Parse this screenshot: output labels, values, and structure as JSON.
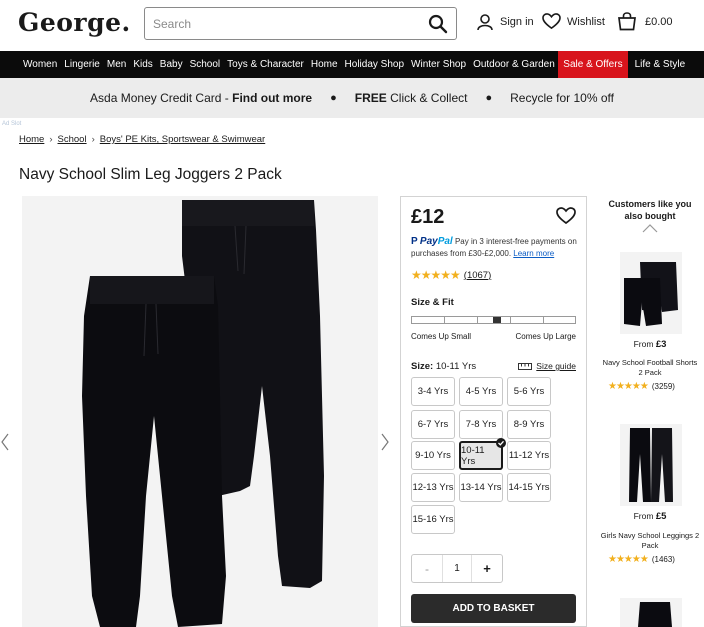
{
  "header": {
    "logo": "George.",
    "search_placeholder": "Search",
    "signin": "Sign in",
    "wishlist": "Wishlist",
    "basket_total": "£0.00"
  },
  "nav": {
    "items": [
      "Women",
      "Lingerie",
      "Men",
      "Kids",
      "Baby",
      "School",
      "Toys & Character",
      "Home",
      "Holiday Shop",
      "Winter Shop",
      "Outdoor & Garden",
      "Sale & Offers",
      "Life & Style"
    ],
    "highlight_color": "#d8141c"
  },
  "promo": {
    "credit_card_prefix": "Asda Money Credit Card - ",
    "credit_card_link": "Find out more",
    "click_collect_bold": "FREE",
    "click_collect_rest": " Click & Collect",
    "recycle": "Recycle for 10% off"
  },
  "tiny_tag": "Ad Slot",
  "breadcrumb": [
    "Home",
    "School",
    "Boys' PE Kits, Sportswear & Swimwear"
  ],
  "product": {
    "title": "Navy School Slim Leg Joggers 2 Pack",
    "price": "£12",
    "paypal_brand_1": "Pay",
    "paypal_brand_2": "Pal",
    "paypal_text": " Pay in 3 interest-free payments on purchases from £30-£2,000. ",
    "paypal_learn": "Learn more",
    "rating_stars": 4.5,
    "rating_count": "(1067)",
    "size_fit_label": "Size & Fit",
    "fit_position": 0.52,
    "fit_small": "Comes Up Small",
    "fit_large": "Comes Up Large",
    "size_label": "Size:",
    "size_selected": " 10-11 Yrs",
    "size_guide": "Size guide",
    "sizes": [
      "3-4 Yrs",
      "4-5 Yrs",
      "5-6 Yrs",
      "6-7 Yrs",
      "7-8 Yrs",
      "8-9 Yrs",
      "9-10 Yrs",
      "10-11 Yrs",
      "11-12 Yrs",
      "12-13 Yrs",
      "13-14 Yrs",
      "14-15 Yrs",
      "15-16 Yrs"
    ],
    "quantity": "1",
    "qty_minus": "-",
    "qty_plus": "+",
    "add_to_basket": "ADD TO BASKET"
  },
  "recs": {
    "title": "Customers like you also bought",
    "items": [
      {
        "from": "From ",
        "price": "£3",
        "name": "Navy School Football Shorts 2 Pack",
        "rating": 5,
        "count": "(3259)"
      },
      {
        "from": "From ",
        "price": "£5",
        "name": "Girls Navy School Leggings 2 Pack",
        "rating": 4.5,
        "count": "(1463)"
      }
    ]
  },
  "colors": {
    "star": "#f2b01e",
    "basket_button": "#2b2b2b",
    "nav_bg": "#0b0b0b",
    "promo_bg": "#ececec"
  }
}
